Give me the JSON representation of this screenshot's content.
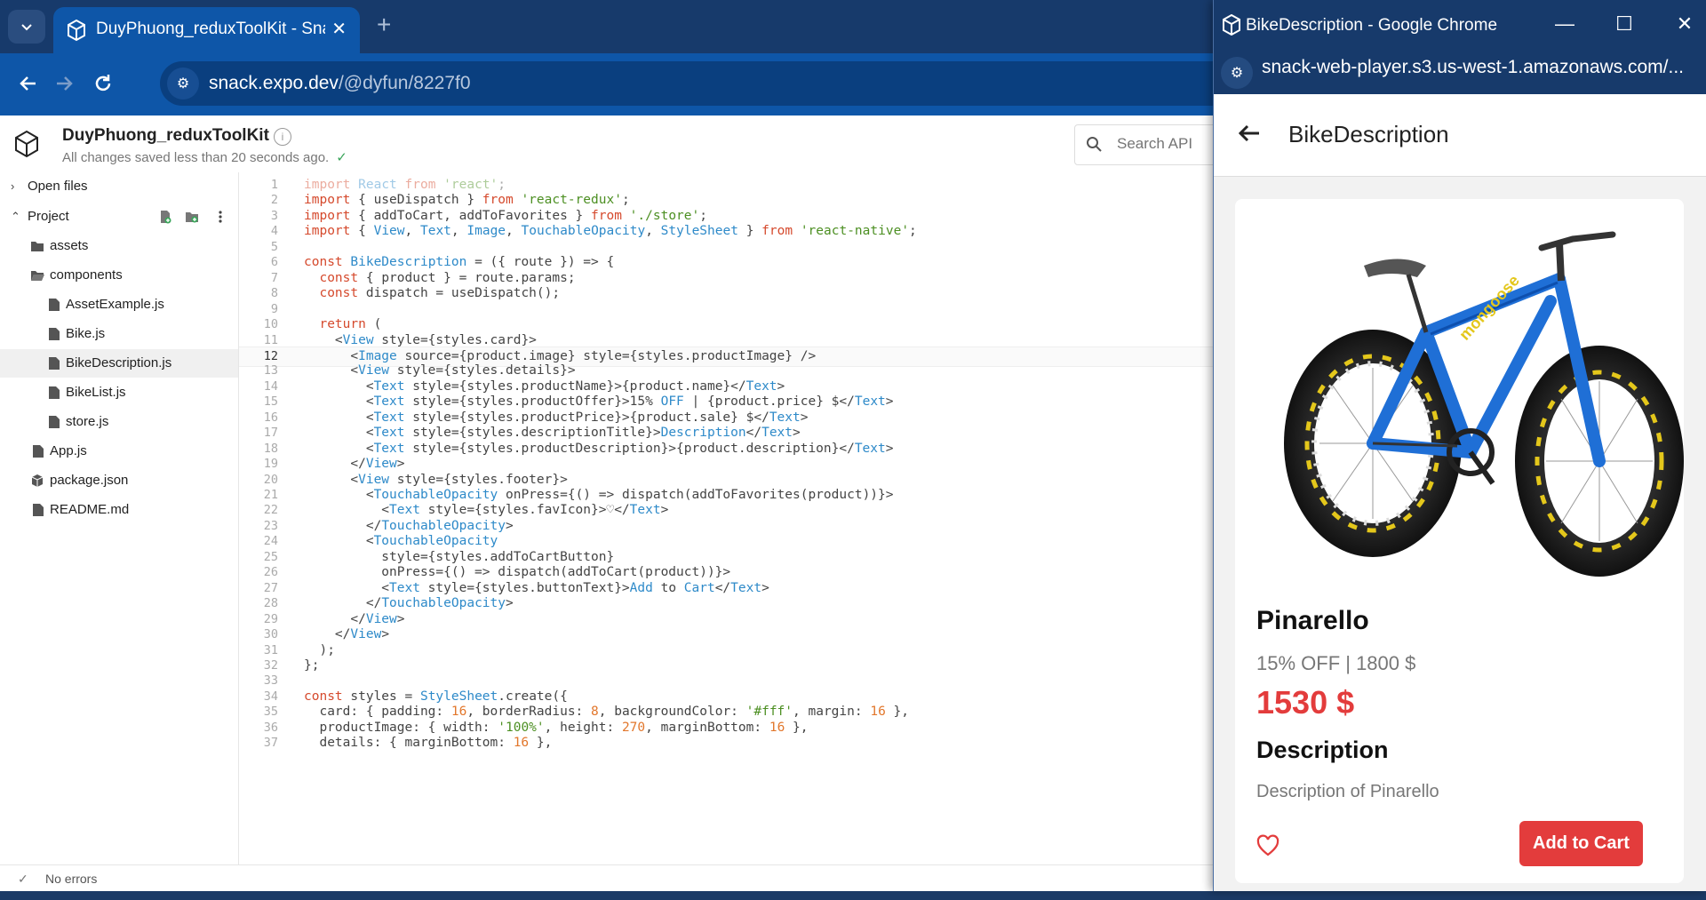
{
  "browser": {
    "tab_title": "DuyPhuong_reduxToolKit - Snack",
    "tab_dropdown_icon": "chevron-down-icon",
    "new_tab_symbol": "+",
    "close_symbol": "✕",
    "url_domain": "snack.expo.dev",
    "url_path": "/@dyfun/8227f0"
  },
  "header": {
    "project_title": "DuyPhuong_reduxToolKit",
    "save_status": "All changes saved less than 20 seconds ago.",
    "save_check": "✓",
    "info_symbol": "i",
    "search_placeholder": "Search API"
  },
  "sidebar": {
    "open_files": "Open files",
    "project": "Project",
    "items": [
      {
        "label": "assets",
        "icon": "folder-icon"
      },
      {
        "label": "components",
        "icon": "folder-open-icon"
      },
      {
        "label": "AssetExample.js",
        "icon": "file-icon"
      },
      {
        "label": "Bike.js",
        "icon": "file-icon"
      },
      {
        "label": "BikeDescription.js",
        "icon": "file-icon"
      },
      {
        "label": "BikeList.js",
        "icon": "file-icon"
      },
      {
        "label": "store.js",
        "icon": "file-icon"
      },
      {
        "label": "App.js",
        "icon": "file-icon"
      },
      {
        "label": "package.json",
        "icon": "package-icon"
      },
      {
        "label": "README.md",
        "icon": "file-icon"
      }
    ]
  },
  "editor": {
    "current_line": 12,
    "lines": [
      {
        "n": "1",
        "t": "import React from 'react';"
      },
      {
        "n": "2",
        "t": "import { useDispatch } from 'react-redux';"
      },
      {
        "n": "3",
        "t": "import { addToCart, addToFavorites } from './store';"
      },
      {
        "n": "4",
        "t": "import { View, Text, Image, TouchableOpacity, StyleSheet } from 'react-native';"
      },
      {
        "n": "5",
        "t": ""
      },
      {
        "n": "6",
        "t": "const BikeDescription = ({ route }) => {"
      },
      {
        "n": "7",
        "t": "  const { product } = route.params;"
      },
      {
        "n": "8",
        "t": "  const dispatch = useDispatch();"
      },
      {
        "n": "9",
        "t": ""
      },
      {
        "n": "10",
        "t": "  return ("
      },
      {
        "n": "11",
        "t": "    <View style={styles.card}>"
      },
      {
        "n": "12",
        "t": "      <Image source={product.image} style={styles.productImage} />"
      },
      {
        "n": "13",
        "t": "      <View style={styles.details}>"
      },
      {
        "n": "14",
        "t": "        <Text style={styles.productName}>{product.name}</Text>"
      },
      {
        "n": "15",
        "t": "        <Text style={styles.productOffer}>15% OFF | {product.price} $</Text>"
      },
      {
        "n": "16",
        "t": "        <Text style={styles.productPrice}>{product.sale} $</Text>"
      },
      {
        "n": "17",
        "t": "        <Text style={styles.descriptionTitle}>Description</Text>"
      },
      {
        "n": "18",
        "t": "        <Text style={styles.productDescription}>{product.description}</Text>"
      },
      {
        "n": "19",
        "t": "      </View>"
      },
      {
        "n": "20",
        "t": "      <View style={styles.footer}>"
      },
      {
        "n": "21",
        "t": "        <TouchableOpacity onPress={() => dispatch(addToFavorites(product))}>"
      },
      {
        "n": "22",
        "t": "          <Text style={styles.favIcon}>♡</Text>"
      },
      {
        "n": "23",
        "t": "        </TouchableOpacity>"
      },
      {
        "n": "24",
        "t": "        <TouchableOpacity"
      },
      {
        "n": "25",
        "t": "          style={styles.addToCartButton}"
      },
      {
        "n": "26",
        "t": "          onPress={() => dispatch(addToCart(product))}>"
      },
      {
        "n": "27",
        "t": "          <Text style={styles.buttonText}>Add to Cart</Text>"
      },
      {
        "n": "28",
        "t": "        </TouchableOpacity>"
      },
      {
        "n": "29",
        "t": "      </View>"
      },
      {
        "n": "30",
        "t": "    </View>"
      },
      {
        "n": "31",
        "t": "  );"
      },
      {
        "n": "32",
        "t": "};"
      },
      {
        "n": "33",
        "t": ""
      },
      {
        "n": "34",
        "t": "const styles = StyleSheet.create({"
      },
      {
        "n": "35",
        "t": "  card: { padding: 16, borderRadius: 8, backgroundColor: '#fff', margin: 16 },"
      },
      {
        "n": "36",
        "t": "  productImage: { width: '100%', height: 270, marginBottom: 16 },"
      },
      {
        "n": "37",
        "t": "  details: { marginBottom: 16 },"
      }
    ]
  },
  "status": {
    "check": "✓",
    "text": "No errors"
  },
  "popup": {
    "window_title": "BikeDescription - Google Chrome",
    "url": "snack-web-player.s3.us-west-1.amazonaws.com/...",
    "minimize": "—",
    "maximize": "☐",
    "close": "✕",
    "screen_title": "BikeDescription",
    "product_name": "Pinarello",
    "product_offer": "15% OFF | 1800 $",
    "product_sale": "1530 $",
    "description_title": "Description",
    "product_description": "Description of Pinarello",
    "add_to_cart": "Add to Cart"
  },
  "colors": {
    "chrome_dark": "#173a6b",
    "chrome_toolbar": "#0e56a8",
    "accent_red": "#e33c3c",
    "keyword": "#d5492c",
    "string": "#4c8f22",
    "type": "#2e8ac9",
    "number": "#e2772c"
  }
}
